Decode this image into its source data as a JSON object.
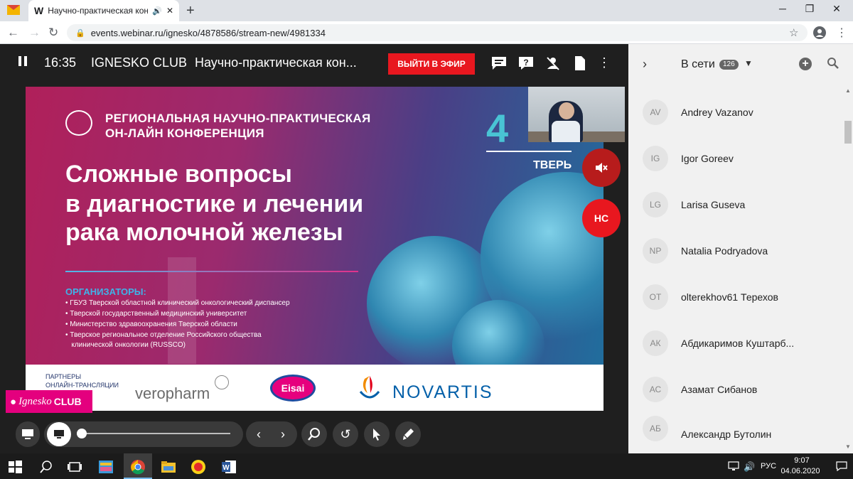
{
  "browser": {
    "tab_title": "Научно-практическая конф",
    "tab_favicon": "W",
    "address": "events.webinar.ru/ignesko/4878586/stream-new/4981334",
    "new_tab": "+",
    "minimize": "─",
    "maximize": "❐",
    "close": "✕"
  },
  "webinar": {
    "time": "16:35",
    "club": "IGNESKO CLUB",
    "title": "Научно-практическая кон...",
    "on_air_button": "ВЫЙТИ В ЭФИР",
    "host_initials": "НС"
  },
  "slide": {
    "conf_line1": "РЕГИОНАЛЬНАЯ НАУЧНО-ПРАКТИЧЕСКАЯ",
    "conf_line2": "ОН-ЛАЙН КОНФЕРЕНЦИЯ",
    "headline": [
      "Сложные вопросы",
      "в диагностике и лечении",
      "рака молочной железы"
    ],
    "date_digit": "4",
    "city": "ТВЕРЬ",
    "organizers_title": "ОРГАНИЗАТОРЫ:",
    "organizers": [
      "• ГБУЗ Тверской областной клинический онкологический диспансер",
      "• Тверской государственный медицинский университет",
      "• Министерство здравоохранения Тверской области",
      "• Тверское региональное отделение Российского общества",
      "   клинической онкологии (RUSSCO)"
    ],
    "partners_label": [
      "ПАРТНЕРЫ",
      "ОНЛАЙН-ТРАНСЛЯЦИИ"
    ],
    "partner1": "veropharm",
    "partner2": "Eisai",
    "partner3": "NOVARTIS"
  },
  "badge": {
    "brand": "Ignesko",
    "club": "CLUB"
  },
  "panel": {
    "online_label": "В сети",
    "online_count": "126",
    "participants": [
      {
        "initials": "AV",
        "name": "Andrey Vazanov"
      },
      {
        "initials": "IG",
        "name": "Igor Goreev"
      },
      {
        "initials": "LG",
        "name": "Larisa Guseva"
      },
      {
        "initials": "NP",
        "name": "Natalia Podryadova"
      },
      {
        "initials": "OT",
        "name": "olterekhov61 Терехов"
      },
      {
        "initials": "АК",
        "name": "Абдикаримов Куштарб..."
      },
      {
        "initials": "АС",
        "name": "Азамат Сибанов"
      },
      {
        "initials": "АБ",
        "name": "Александр Бутолин"
      }
    ]
  },
  "taskbar": {
    "lang": "РУС",
    "time": "9:07",
    "date": "04.06.2020"
  }
}
